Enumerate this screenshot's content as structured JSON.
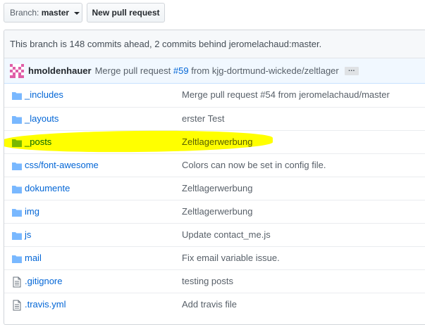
{
  "toolbar": {
    "branch_prefix": "Branch:",
    "branch_value": "master",
    "new_pr_label": "New pull request"
  },
  "status": {
    "text": "This branch is 148 commits ahead, 2 commits behind jeromelachaud:master."
  },
  "latest_commit": {
    "author": "hmoldenhauer",
    "message_prefix": "Merge pull request",
    "pr_number": "#59",
    "message_suffix": "from kjg-dortmund-wickede/zeltlager",
    "ellipsis": "…"
  },
  "files": [
    {
      "name": "_includes",
      "message": "Merge pull request #54 from jeromelachaud/master",
      "icon": "folder-icon"
    },
    {
      "name": "_layouts",
      "message": "erster Test",
      "icon": "folder-icon"
    },
    {
      "name": "_posts",
      "message": "Zeltlagerwerbung",
      "icon": "folder-icon"
    },
    {
      "name": "css/font-awesome",
      "message": "Colors can now be set in config file.",
      "icon": "folder-icon"
    },
    {
      "name": "dokumente",
      "message": "Zeltlagerwerbung",
      "icon": "folder-icon"
    },
    {
      "name": "img",
      "message": "Zeltlagerwerbung",
      "icon": "folder-icon"
    },
    {
      "name": "js",
      "message": "Update contact_me.js",
      "icon": "folder-icon"
    },
    {
      "name": "mail",
      "message": "Fix email variable issue.",
      "icon": "folder-icon"
    },
    {
      "name": ".gitignore",
      "message": "testing posts",
      "icon": "file-icon"
    },
    {
      "name": ".travis.yml",
      "message": "Add travis file",
      "icon": "file-icon"
    }
  ],
  "colors": {
    "link": "#0366d6",
    "folder": "#79b8ff",
    "highlight": "#ffff00",
    "commit_bar": "#f1f8ff"
  }
}
